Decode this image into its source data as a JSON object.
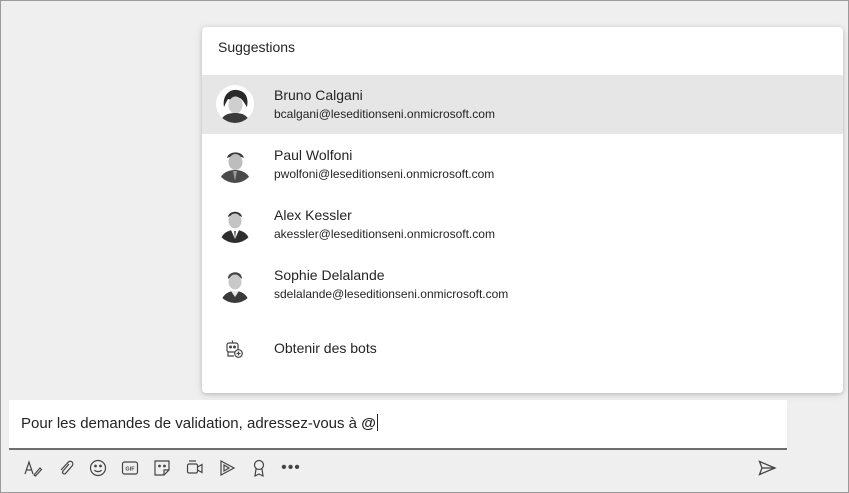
{
  "suggestions_popup": {
    "title": "Suggestions",
    "people": [
      {
        "name": "Bruno Calgani",
        "email": "bcalgani@leseditionseni.onmicrosoft.com",
        "avatar_icon": "user-photo-avatar"
      },
      {
        "name": "Paul Wolfoni",
        "email": "pwolfoni@leseditionseni.onmicrosoft.com",
        "avatar_icon": "user-photo-avatar"
      },
      {
        "name": "Alex Kessler",
        "email": "akessler@leseditionseni.onmicrosoft.com",
        "avatar_icon": "user-photo-avatar"
      },
      {
        "name": "Sophie Delalande",
        "email": "sdelalande@leseditionseni.onmicrosoft.com",
        "avatar_icon": "user-photo-avatar"
      }
    ],
    "get_bots_label": "Obtenir des bots",
    "get_bots_icon": "bot-add-icon"
  },
  "compose": {
    "text": "Pour les demandes de validation, adressez-vous à ",
    "mention_trigger": "@"
  },
  "toolbar": {
    "icons": [
      "format-icon",
      "attach-icon",
      "emoji-icon",
      "gif-icon",
      "sticker-icon",
      "meet-now-icon",
      "stream-icon",
      "praise-icon",
      "more-options-icon"
    ],
    "more_label": "•••",
    "send_icon": "send-icon"
  },
  "colors": {
    "background": "#efefef",
    "popup_background": "#ffffff",
    "selected_row": "#e6e6e6",
    "text": "#242424"
  }
}
